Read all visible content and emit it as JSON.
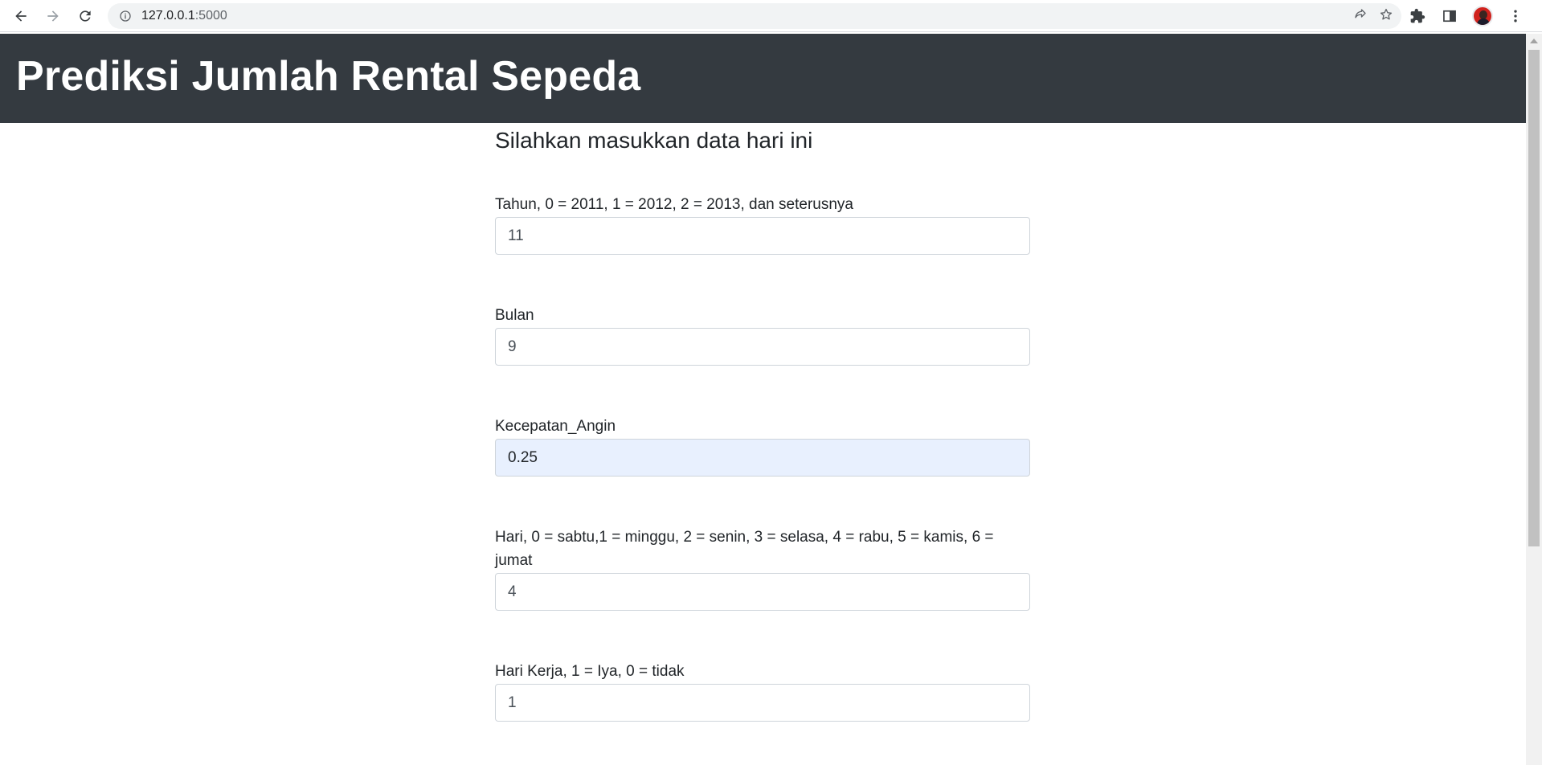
{
  "browser": {
    "url_host": "127.0.0.1",
    "url_port": ":5000"
  },
  "header": {
    "title": "Prediksi Jumlah Rental Sepeda"
  },
  "form": {
    "subtitle": "Silahkan masukkan data hari ini",
    "fields": [
      {
        "label": "Tahun, 0 = 2011, 1 = 2012, 2 = 2013, dan seterusnya",
        "value": "11"
      },
      {
        "label": "Bulan",
        "value": "9"
      },
      {
        "label": "Kecepatan_Angin",
        "value": "0.25"
      },
      {
        "label": "Hari, 0 = sabtu,1 = minggu, 2 = senin, 3 = selasa, 4 = rabu, 5 = kamis, 6 = jumat",
        "value": "4"
      },
      {
        "label": "Hari Kerja, 1 = Iya, 0 = tidak",
        "value": "1"
      }
    ]
  },
  "colors": {
    "header_bg": "#343a40",
    "autofill_bg": "#e8f0fe"
  }
}
